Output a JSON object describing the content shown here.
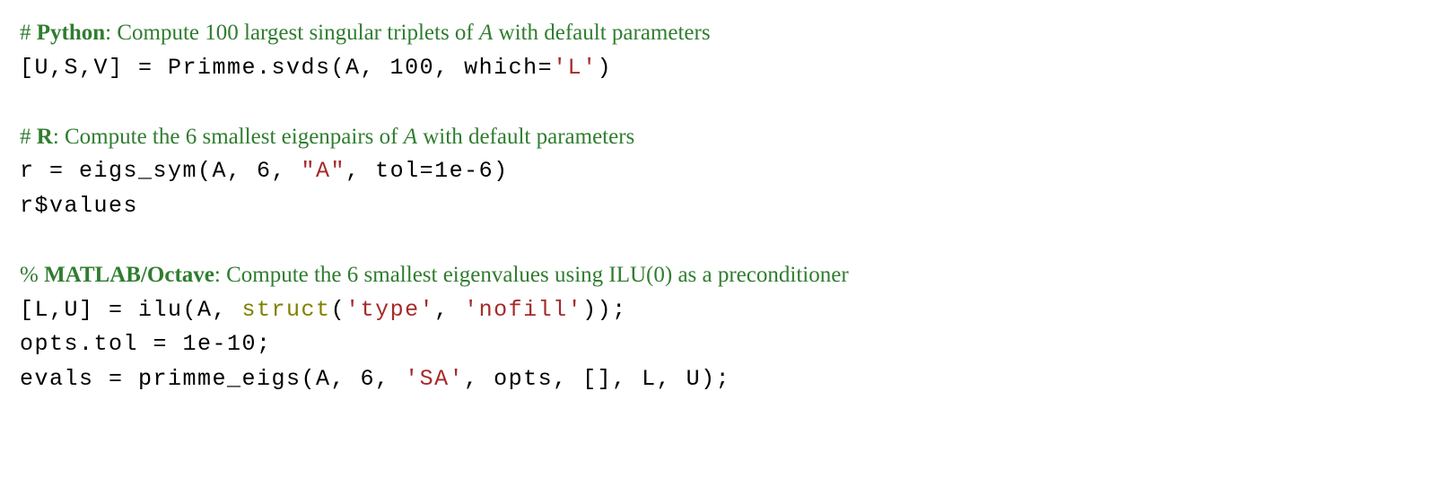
{
  "blocks": [
    {
      "comment_prefix": "#",
      "lang": "Python",
      "comment_rest": ": Compute 100 largest singular triplets of ",
      "italic_var": "A",
      "comment_tail": " with default parameters",
      "code": [
        {
          "spans": [
            {
              "t": "[U,S,V] = Primme.svds(A, 100, which=",
              "cls": ""
            },
            {
              "t": "'L'",
              "cls": "str"
            },
            {
              "t": ")",
              "cls": ""
            }
          ]
        }
      ]
    },
    {
      "comment_prefix": "#",
      "lang": "R",
      "comment_rest": ": Compute the 6 smallest eigenpairs of ",
      "italic_var": "A",
      "comment_tail": " with default parameters",
      "code": [
        {
          "spans": [
            {
              "t": "r = eigs_sym(A, 6, ",
              "cls": ""
            },
            {
              "t": "\"A\"",
              "cls": "str"
            },
            {
              "t": ", tol=1e-6)",
              "cls": ""
            }
          ]
        },
        {
          "spans": [
            {
              "t": "r$values",
              "cls": ""
            }
          ]
        }
      ]
    },
    {
      "comment_prefix": "%",
      "lang": "MATLAB/Octave",
      "comment_rest": ": Compute the 6 smallest eigenvalues using ILU(0) as a preconditioner",
      "italic_var": "",
      "comment_tail": "",
      "code": [
        {
          "spans": [
            {
              "t": "[L,U] = ilu(A, ",
              "cls": ""
            },
            {
              "t": "struct",
              "cls": "kw"
            },
            {
              "t": "(",
              "cls": ""
            },
            {
              "t": "'type'",
              "cls": "str"
            },
            {
              "t": ", ",
              "cls": ""
            },
            {
              "t": "'nofill'",
              "cls": "str"
            },
            {
              "t": "));",
              "cls": ""
            }
          ]
        },
        {
          "spans": [
            {
              "t": "opts.tol = 1e-10;",
              "cls": ""
            }
          ]
        },
        {
          "spans": [
            {
              "t": "evals = primme_eigs(A, 6, ",
              "cls": ""
            },
            {
              "t": "'SA'",
              "cls": "str"
            },
            {
              "t": ", opts, [], L, U);",
              "cls": ""
            }
          ]
        }
      ]
    }
  ]
}
